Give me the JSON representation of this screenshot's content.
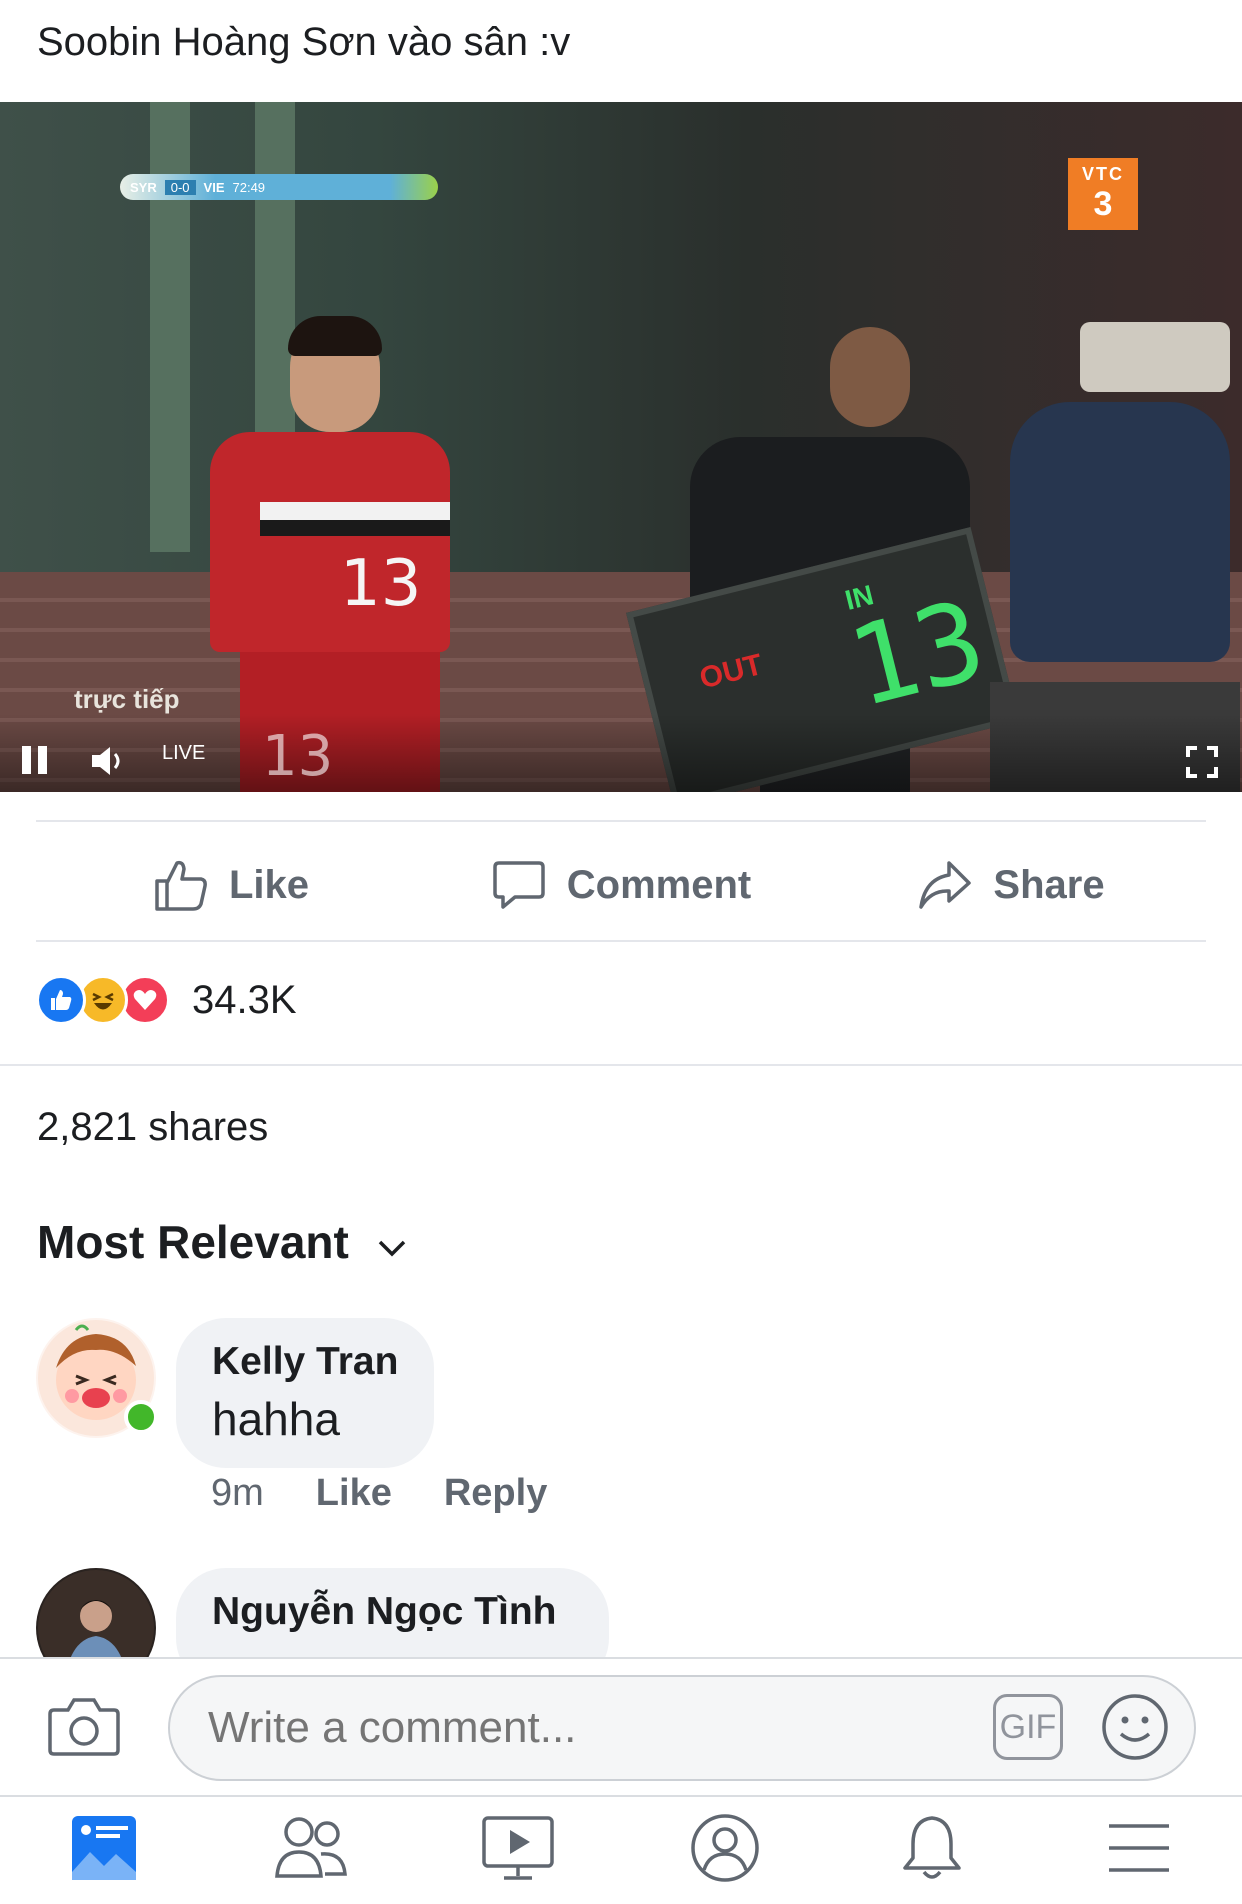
{
  "post": {
    "caption": "Soobin Hoàng Sơn vào sân :v"
  },
  "video": {
    "score_bug": {
      "home": "SYR",
      "score": "0-0",
      "away": "VIE",
      "clock": "72:49"
    },
    "channel": {
      "top": "VTC",
      "bottom": "3"
    },
    "live_caption": "trực tiếp",
    "live_label": "LIVE",
    "overlay_number": "13",
    "jersey_number": "13",
    "board": {
      "out": "OUT",
      "in": "IN",
      "number": "13"
    },
    "controls": {
      "pause_icon": "pause-icon",
      "volume_icon": "volume-icon",
      "fullscreen_icon": "fullscreen-icon"
    }
  },
  "actions": {
    "like": "Like",
    "comment": "Comment",
    "share": "Share"
  },
  "reactions": {
    "types": [
      "like",
      "haha",
      "love"
    ],
    "colors": {
      "like": "#1877f2",
      "haha": "#f7b928",
      "love": "#f33e58"
    },
    "count": "34.3K"
  },
  "shares": "2,821 shares",
  "sort": {
    "label": "Most Relevant",
    "icon": "chevron-down-icon"
  },
  "comments": [
    {
      "author": "Kelly Tran",
      "text": "hahha",
      "time": "9m",
      "like": "Like",
      "reply": "Reply"
    },
    {
      "author": "Nguyễn Ngọc Tình",
      "text": ""
    }
  ],
  "composer": {
    "placeholder": "Write a comment...",
    "gif": "GIF"
  },
  "tabbar": [
    "news-feed-icon",
    "friends-icon",
    "watch-icon",
    "profile-icon",
    "notifications-icon",
    "menu-icon"
  ],
  "colors": {
    "brand": "#1877f2",
    "text": "#1c1e21",
    "secondary_text": "#606770"
  }
}
